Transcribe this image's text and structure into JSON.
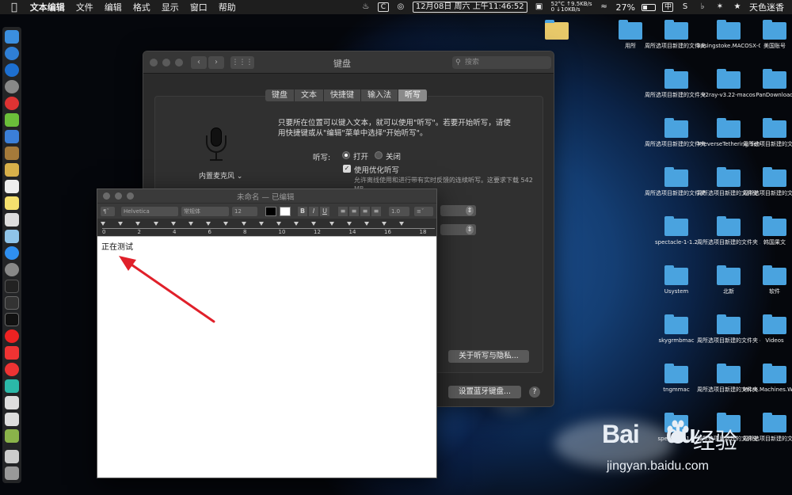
{
  "menubar": {
    "app_name": "文本编辑",
    "menus": [
      "文件",
      "编辑",
      "格式",
      "显示",
      "窗口",
      "帮助"
    ],
    "date_time": "12月08日 周六 上午11:46:52",
    "net_up": "52°C ↑9.5KB/s",
    "net_down": "0  ↓10KB/s",
    "battery": "27%",
    "input_method": "中",
    "user": "天色迷香"
  },
  "prefs": {
    "title": "键盘",
    "search_placeholder": "搜索",
    "tabs": [
      "键盘",
      "文本",
      "快捷键",
      "输入法",
      "听写"
    ],
    "active_tab": "听写",
    "mic_label": "内置麦克风",
    "description": "只要所在位置可以键入文本，就可以使用\"听写\"。若要开始听写，请使用快捷键或从\"编辑\"菜单中选择\"开始听写\"。",
    "dictation_label": "听写:",
    "on_label": "打开",
    "off_label": "关闭",
    "enhanced_label": "使用优化听写",
    "enhanced_sub": "允许离线使用和进行带有实时反馈的连续听写。这要求下载 542 MB",
    "privacy_button": "关于听写与隐私...",
    "bluetooth_button": "设置蓝牙键盘...",
    "help": "?"
  },
  "textedit": {
    "title": "未命名 — 已编辑",
    "font_family": "Helvetica",
    "font_style": "常规体",
    "font_size": "12",
    "spacing": "1.0",
    "bold": "B",
    "italic": "I",
    "underline": "U",
    "ruler_numbers": [
      "0",
      "2",
      "4",
      "6",
      "8",
      "10",
      "12",
      "14",
      "16",
      "18"
    ],
    "content": "正在测试"
  },
  "desktop": {
    "items": [
      "用所",
      "周所选项目新建的文件夹 2",
      "Basingstoke.MACOSX-GOG",
      "美国账号",
      "周所选项目新建的文件夹 10",
      "v2ray-v3.22-macos",
      "PanDownload",
      "周所选项目新建的文件夹 9",
      "#reverseTethering Server_1.2.0",
      "周所选项目新建的文件夹 8",
      "周所选项目新建的文件夹 13",
      "周所选项目新建的文件夹 7",
      "周所选项目新建的文件夹 12",
      "spectacle-1-1.2",
      "周所选项目新建的文件夹 3",
      "韩国果文",
      "Usystem",
      "北新",
      "软件",
      "skygrmbmac",
      "周所选项目新建的文件夹 4",
      "Videos",
      "tngmmac",
      "周所选项目新建的文件夹 5",
      "Micro.Machines.WATED",
      "spectacle-1.2",
      "周所选项目新建的文件夹 11",
      "周所选项目新建的文件夹 14"
    ]
  },
  "watermark": {
    "logo": "Bai",
    "logo_du": "du",
    "cn": "经验",
    "url": "jingyan.baidu.com"
  },
  "colors": {
    "folder": "#4aa3df",
    "arrow": "#e0202a",
    "accent_tab": "#8a8a8a"
  }
}
